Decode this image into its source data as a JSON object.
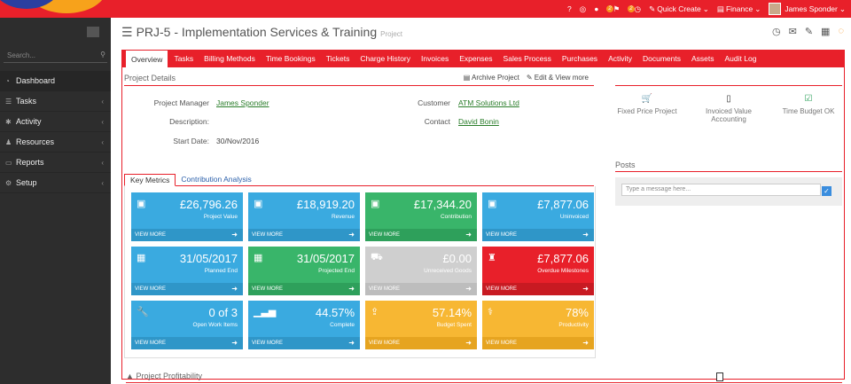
{
  "topbar": {
    "help_icon": "?",
    "badges": [
      "2",
      "2"
    ],
    "quick_create": "Quick Create",
    "finance": "Finance",
    "user": "James Sponder"
  },
  "sidebar": {
    "search_placeholder": "Search...",
    "items": [
      {
        "label": "Dashboard",
        "icon": "dashboard-icon"
      },
      {
        "label": "Tasks",
        "icon": "tasks-icon"
      },
      {
        "label": "Activity",
        "icon": "activity-icon"
      },
      {
        "label": "Resources",
        "icon": "resources-icon"
      },
      {
        "label": "Reports",
        "icon": "reports-icon"
      },
      {
        "label": "Setup",
        "icon": "setup-icon"
      }
    ]
  },
  "page": {
    "title": "PRJ-5 - Implementation Services & Training",
    "subtitle": "Project"
  },
  "tabs": [
    "Overview",
    "Tasks",
    "Billing Methods",
    "Time Bookings",
    "Tickets",
    "Charge History",
    "Invoices",
    "Expenses",
    "Sales Process",
    "Purchases",
    "Activity",
    "Documents",
    "Assets",
    "Audit Log"
  ],
  "project_details": {
    "heading": "Project Details",
    "archive": "Archive Project",
    "edit": "Edit & View more",
    "pm_label": "Project Manager",
    "pm_value": "James Sponder",
    "desc_label": "Description:",
    "start_label": "Start Date:",
    "start_value": "30/Nov/2016",
    "customer_label": "Customer",
    "customer_value": "ATM Solutions Ltd",
    "contact_label": "Contact",
    "contact_value": "David Bonin"
  },
  "summary_icons": [
    {
      "label": "Fixed Price Project"
    },
    {
      "label": "Invoiced Value Accounting"
    },
    {
      "label": "Time Budget OK"
    }
  ],
  "posts": {
    "heading": "Posts",
    "placeholder": "Type a message here..."
  },
  "metrics_tabs": [
    "Key Metrics",
    "Contribution Analysis"
  ],
  "tiles": [
    {
      "value": "£26,796.26",
      "label": "Project Value",
      "footer": "VIEW MORE",
      "color": "#3aaae0"
    },
    {
      "value": "£18,919.20",
      "label": "Revenue",
      "footer": "VIEW MORE",
      "color": "#3aaae0"
    },
    {
      "value": "£17,344.20",
      "label": "Contribution",
      "footer": "VIEW MORE",
      "color": "#39b56a"
    },
    {
      "value": "£7,877.06",
      "label": "Uninvoiced",
      "footer": "VIEW MORE",
      "color": "#3aaae0"
    },
    {
      "value": "31/05/2017",
      "label": "Planned End",
      "footer": "VIEW MORE",
      "color": "#3aaae0"
    },
    {
      "value": "31/05/2017",
      "label": "Projected End",
      "footer": "VIEW MORE",
      "color": "#39b56a"
    },
    {
      "value": "£0.00",
      "label": "Unreceived Goods",
      "footer": "VIEW MORE",
      "color": "#cfcfcf"
    },
    {
      "value": "£7,877.06",
      "label": "Overdue Milestones",
      "footer": "VIEW MORE",
      "color": "#e8202a"
    },
    {
      "value": "0 of 3",
      "label": "Open Work Items",
      "footer": "VIEW MORE",
      "color": "#3aaae0"
    },
    {
      "value": "44.57%",
      "label": "Complete",
      "footer": "VIEW MORE",
      "color": "#3aaae0"
    },
    {
      "value": "57.14%",
      "label": "Budget Spent",
      "footer": "VIEW MORE",
      "color": "#f7b733"
    },
    {
      "value": "78%",
      "label": "Productivity",
      "footer": "VIEW MORE",
      "color": "#f7b733"
    }
  ],
  "profitability": "Project Profitability"
}
